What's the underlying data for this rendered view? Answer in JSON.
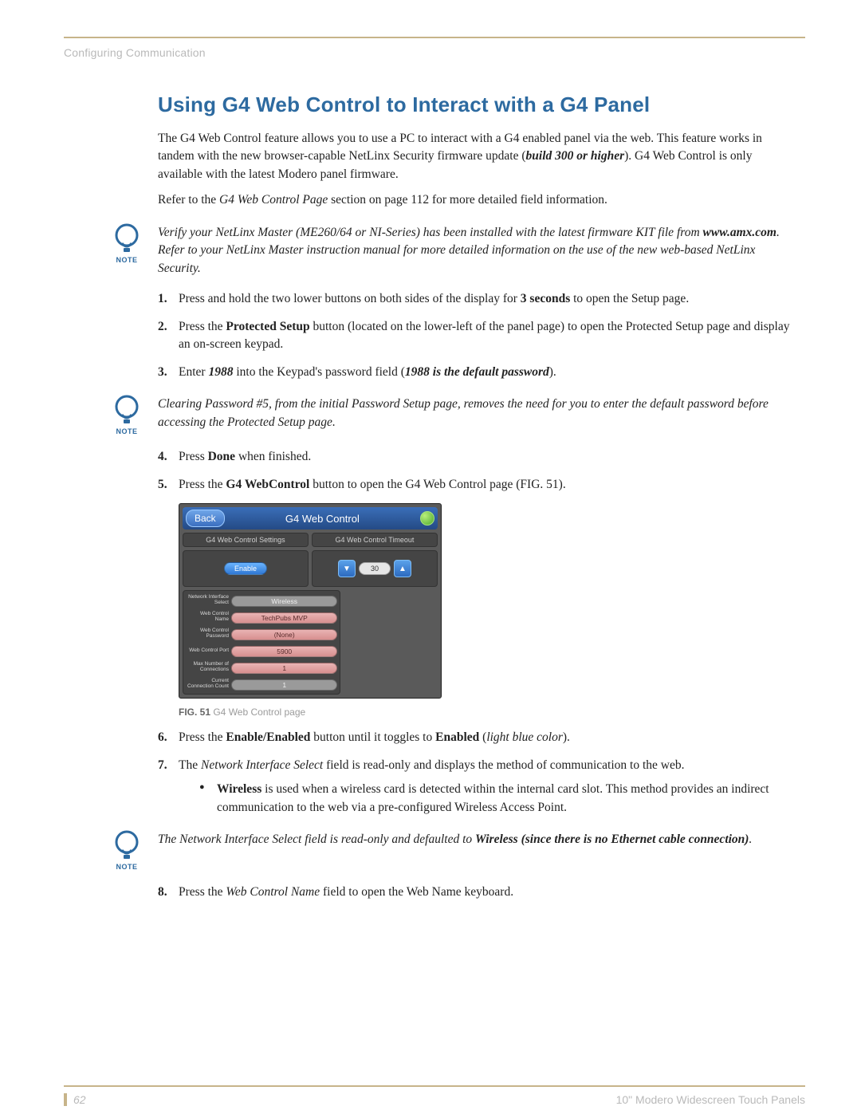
{
  "header": {
    "section": "Configuring Communication"
  },
  "title": "Using G4 Web Control to Interact with a G4 Panel",
  "intro": {
    "p1a": "The G4 Web Control feature allows you to use a PC to interact with a G4 enabled panel via the web. This feature works in tandem with the new browser-capable NetLinx Security firmware update (",
    "p1b": "build 300 or higher",
    "p1c": "). G4 Web Control is only available with the latest Modero panel firmware.",
    "p2a": "Refer to the ",
    "p2b": "G4 Web Control Page",
    "p2c": " section on page 112 for more detailed field information."
  },
  "note1": {
    "a": "Verify your NetLinx Master (ME260/64 or NI-Series) has been installed with the latest firmware KIT file from ",
    "b": "www.amx.com",
    "c": ". Refer to your NetLinx Master instruction manual for more detailed information on the use of the new web-based NetLinx Security."
  },
  "note_label": "NOTE",
  "steps_a": {
    "s1a": "Press and hold the two lower buttons on both sides of the display for ",
    "s1b": "3 seconds",
    "s1c": " to open the Setup page.",
    "s2a": "Press the ",
    "s2b": "Protected Setup",
    "s2c": " button (located on the lower-left of the panel page) to open the Protected Setup page and display an on-screen keypad.",
    "s3a": "Enter ",
    "s3b": "1988",
    "s3c": " into the Keypad's password field (",
    "s3d": "1988 is the default password",
    "s3e": ")."
  },
  "note2": "Clearing Password #5, from the initial Password Setup page, removes the need for you to enter the default password before accessing the Protected Setup page.",
  "steps_b": {
    "s4a": "Press ",
    "s4b": "Done",
    "s4c": " when finished.",
    "s5a": "Press the ",
    "s5b": "G4 WebControl",
    "s5c": " button to open the G4 Web Control page (FIG. 51)."
  },
  "figure": {
    "back": "Back",
    "title": "G4 Web Control",
    "tab1": "G4 Web Control Settings",
    "tab2": "G4 Web Control Timeout",
    "enable": "Enable",
    "timeout": "30",
    "rows": [
      {
        "label": "Network Interface Select",
        "value": "Wireless",
        "style": "gray"
      },
      {
        "label": "Web Control Name",
        "value": "TechPubs MVP",
        "style": "pink"
      },
      {
        "label": "Web Control Password",
        "value": "(None)",
        "style": "pink"
      },
      {
        "label": "Web Control Port",
        "value": "5900",
        "style": "pink"
      },
      {
        "label": "Max Number of Connections",
        "value": "1",
        "style": "pink"
      },
      {
        "label": "Current Connection Count",
        "value": "1",
        "style": "gray"
      }
    ],
    "caption_b": "FIG. 51",
    "caption": "  G4 Web Control page"
  },
  "steps_c": {
    "s6a": "Press the ",
    "s6b": "Enable/Enabled",
    "s6c": " button until it toggles to ",
    "s6d": "Enabled",
    "s6e": " (",
    "s6f": "light blue color",
    "s6g": ").",
    "s7a": "The ",
    "s7b": "Network Interface Select",
    "s7c": " field is read-only and displays the method of communication to the web.",
    "bullet_a": "Wireless",
    "bullet_b": " is used when a wireless card is detected within the internal card slot. This method provides an indirect communication to the web via a pre-configured Wireless Access Point."
  },
  "note3": {
    "a": "The Network Interface Select field is read-only and defaulted to ",
    "b": "Wireless (since there is no Ethernet cable connection)",
    "c": "."
  },
  "steps_d": {
    "s8a": "Press the ",
    "s8b": "Web Control Name",
    "s8c": " field to open the Web Name keyboard."
  },
  "footer": {
    "page": "62",
    "doc": "10\" Modero Widescreen Touch Panels"
  }
}
